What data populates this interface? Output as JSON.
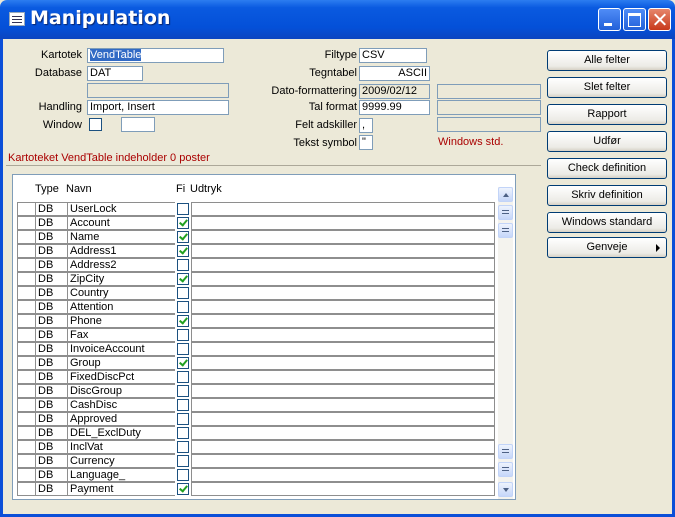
{
  "window": {
    "title": "Manipulation"
  },
  "form": {
    "kartotek_label": "Kartotek",
    "kartotek_value": "VendTable",
    "database_label": "Database",
    "database_value": "DAT",
    "handling_label": "Handling",
    "handling_value": "Import, Insert",
    "window_label": "Window",
    "filtype_label": "Filtype",
    "filtype_value": "CSV",
    "tegntabel_label": "Tegntabel",
    "tegntabel_value": "ASCII",
    "dato_label": "Dato-formattering",
    "dato_value": "2009/02/12",
    "talformat_label": "Tal format",
    "talformat_value": "9999.99",
    "feltadskiller_label": "Felt adskiller",
    "feltadskiller_value": ",",
    "tekstsymbol_label": "Tekst symbol",
    "tekstsymbol_value": "\"",
    "windows_std": "Windows std."
  },
  "status_text": "Kartoteket VendTable indeholder 0 poster",
  "buttons": {
    "alle_felter": "Alle felter",
    "slet_felter": "Slet felter",
    "rapport": "Rapport",
    "udfor": "Udfør",
    "check_definition": "Check definition",
    "skriv_definition": "Skriv definition",
    "windows_standard": "Windows standard",
    "genveje": "Genveje"
  },
  "grid": {
    "headers": {
      "type": "Type",
      "navn": "Navn",
      "fi": "Fi",
      "udtryk": "Udtryk"
    },
    "rows": [
      {
        "type": "DB",
        "name": "UserLock",
        "checked": false
      },
      {
        "type": "DB",
        "name": "Account",
        "checked": true
      },
      {
        "type": "DB",
        "name": "Name",
        "checked": true
      },
      {
        "type": "DB",
        "name": "Address1",
        "checked": true
      },
      {
        "type": "DB",
        "name": "Address2",
        "checked": false
      },
      {
        "type": "DB",
        "name": "ZipCity",
        "checked": true
      },
      {
        "type": "DB",
        "name": "Country",
        "checked": false
      },
      {
        "type": "DB",
        "name": "Attention",
        "checked": false
      },
      {
        "type": "DB",
        "name": "Phone",
        "checked": true
      },
      {
        "type": "DB",
        "name": "Fax",
        "checked": false
      },
      {
        "type": "DB",
        "name": "InvoiceAccount",
        "checked": false
      },
      {
        "type": "DB",
        "name": "Group",
        "checked": true
      },
      {
        "type": "DB",
        "name": "FixedDiscPct",
        "checked": false
      },
      {
        "type": "DB",
        "name": "DiscGroup",
        "checked": false
      },
      {
        "type": "DB",
        "name": "CashDisc",
        "checked": false
      },
      {
        "type": "DB",
        "name": "Approved",
        "checked": false
      },
      {
        "type": "DB",
        "name": "DEL_ExclDuty",
        "checked": false
      },
      {
        "type": "DB",
        "name": "InclVat",
        "checked": false
      },
      {
        "type": "DB",
        "name": "Currency",
        "checked": false
      },
      {
        "type": "DB",
        "name": "Language_",
        "checked": false
      },
      {
        "type": "DB",
        "name": "Payment",
        "checked": true
      }
    ]
  }
}
